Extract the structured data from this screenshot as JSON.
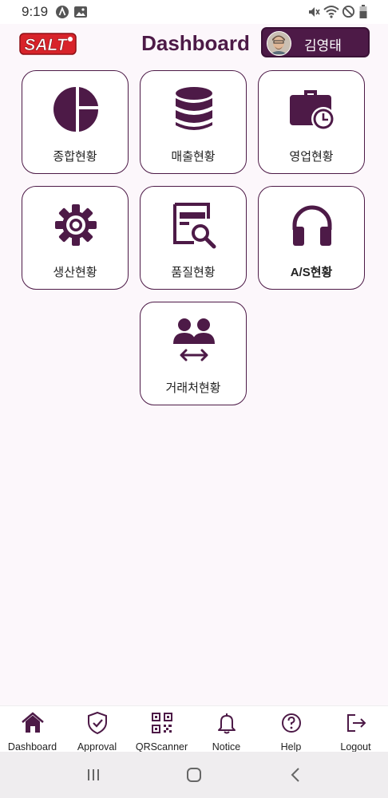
{
  "status_bar": {
    "time": "9:19"
  },
  "header": {
    "title": "Dashboard",
    "user_name": "김영태",
    "logo_text": "SALT"
  },
  "tiles": [
    {
      "label": "종합현황",
      "icon": "pie-chart-icon"
    },
    {
      "label": "매출현황",
      "icon": "database-icon"
    },
    {
      "label": "영업현황",
      "icon": "briefcase-clock-icon"
    },
    {
      "label": "생산현황",
      "icon": "gear-icon"
    },
    {
      "label": "품질현황",
      "icon": "document-search-icon"
    },
    {
      "label": "A/S현황",
      "icon": "headphones-icon"
    },
    {
      "label": "거래처현황",
      "icon": "people-exchange-icon"
    }
  ],
  "bottom_nav": [
    {
      "label": "Dashboard",
      "icon": "home-icon"
    },
    {
      "label": "Approval",
      "icon": "shield-check-icon"
    },
    {
      "label": "QRScanner",
      "icon": "qr-code-icon"
    },
    {
      "label": "Notice",
      "icon": "bell-icon"
    },
    {
      "label": "Help",
      "icon": "help-circle-icon"
    },
    {
      "label": "Logout",
      "icon": "logout-icon"
    }
  ],
  "colors": {
    "primary": "#4d1a47",
    "background": "#fcf7fb",
    "logo_red": "#d8232a"
  }
}
